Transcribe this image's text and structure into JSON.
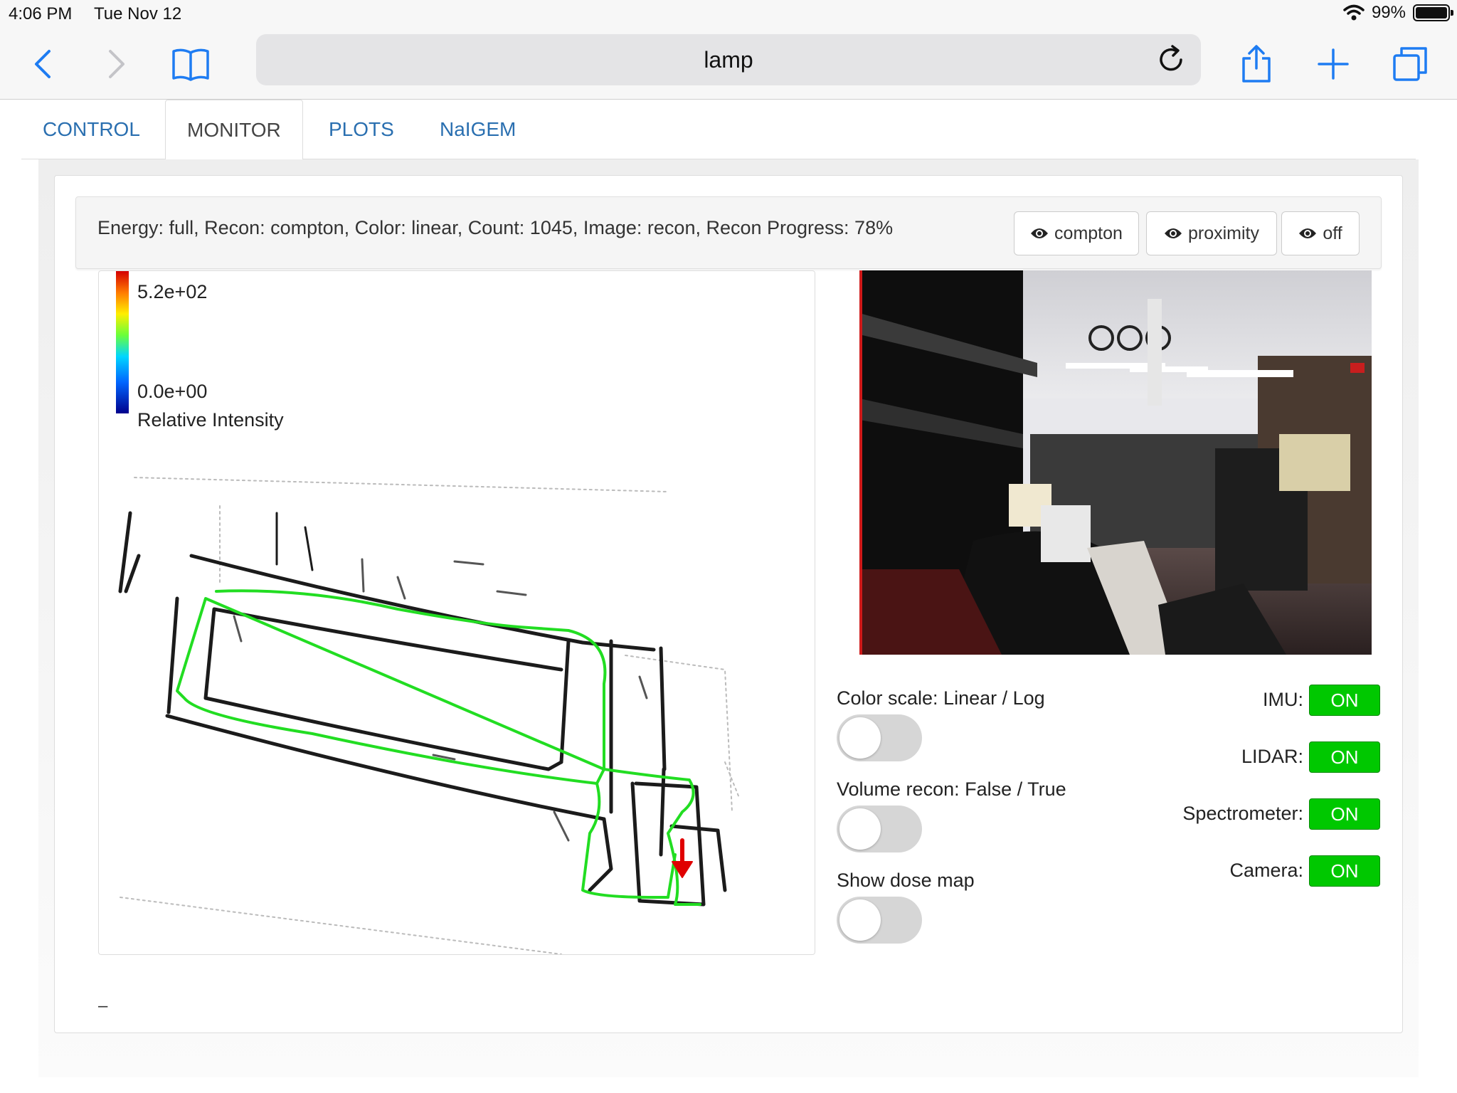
{
  "status_bar": {
    "time": "4:06 PM",
    "date": "Tue Nov 12",
    "battery": "99%"
  },
  "browser": {
    "url": "lamp",
    "icons": [
      "back-icon",
      "forward-icon",
      "bookmarks-icon",
      "reload-icon",
      "share-icon",
      "new-tab-icon",
      "tabs-icon"
    ]
  },
  "tabs": [
    {
      "label": "CONTROL",
      "active": false
    },
    {
      "label": "MONITOR",
      "active": true
    },
    {
      "label": "PLOTS",
      "active": false
    },
    {
      "label": "NaIGEM",
      "active": false
    }
  ],
  "info": {
    "summary": "Energy: full, Recon: compton, Color: linear, Count: 1045, Image: recon, Recon Progress: 78%",
    "buttons": [
      "compton",
      "proximity",
      "off"
    ]
  },
  "colorbar": {
    "max": "5.2e+02",
    "min": "0.0e+00",
    "label": "Relative Intensity"
  },
  "controls": [
    {
      "label": "Color scale: Linear / Log",
      "on": false
    },
    {
      "label": "Volume recon: False / True",
      "on": false
    },
    {
      "label": "Show dose map",
      "on": false
    }
  ],
  "sensors": [
    {
      "label": "IMU:",
      "state": "ON"
    },
    {
      "label": "LIDAR:",
      "state": "ON"
    },
    {
      "label": "Spectrometer:",
      "state": "ON"
    },
    {
      "label": "Camera:",
      "state": "ON"
    }
  ],
  "footer": {
    "dash": "–"
  },
  "colors": {
    "accent": "#2a6fb0",
    "path": "#22dd22",
    "on": "#00c800",
    "marker": "#e00000"
  }
}
